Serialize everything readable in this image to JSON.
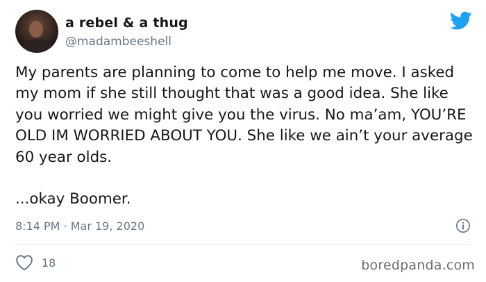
{
  "author": {
    "display_name": "a rebel & a thug",
    "handle": "@madambeeshell",
    "avatar_icon": "user-avatar-photo"
  },
  "brand": {
    "logo_icon": "twitter-bird-icon",
    "color": "#1da1f2"
  },
  "tweet": {
    "paragraphs": [
      "My parents are planning to come to help me move. I asked my mom if she still thought that was a good idea. She like you worried we might give you the virus. No ma’am, YOU’RE OLD IM WORRIED ABOUT YOU. She like we ain’t your average 60 year olds.",
      "...okay Boomer."
    ],
    "timestamp": "8:14 PM · Mar 19, 2020"
  },
  "actions": {
    "like_icon": "heart-outline-icon",
    "like_count": "18",
    "info_icon": "info-circle-icon"
  },
  "watermark": "boredpanda.com",
  "colors": {
    "text": "#14171a",
    "secondary_text": "#657786",
    "divider": "#e1e8ed"
  }
}
